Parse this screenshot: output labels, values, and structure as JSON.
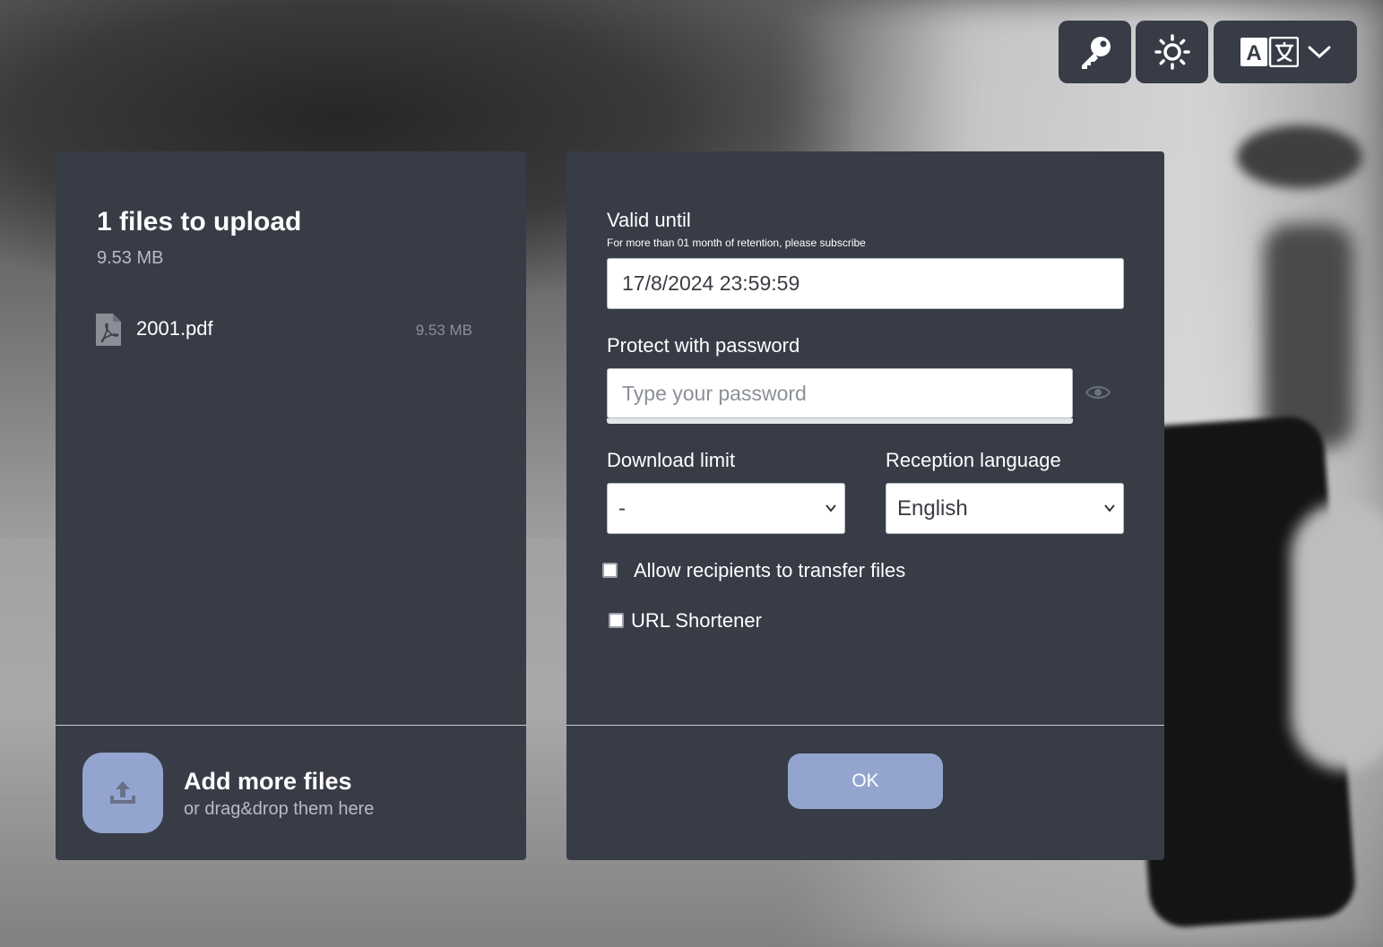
{
  "toolbar": {
    "key_icon": "key-icon",
    "theme_icon": "sun-icon",
    "language_icon": "translate-icon",
    "language_dropdown_icon": "chevron-down-icon"
  },
  "upload": {
    "title": "1 files to upload",
    "total_size": "9.53 MB",
    "files": [
      {
        "name": "2001.pdf",
        "size": "9.53 MB",
        "icon": "pdf-file-icon"
      }
    ],
    "add_more_title": "Add more files",
    "add_more_subtitle": "or drag&drop them here"
  },
  "options": {
    "valid_until_label": "Valid until",
    "valid_until_hint": "For more than 01 month of retention, please subscribe",
    "valid_until_value": "17/8/2024 23:59:59",
    "password_label": "Protect with password",
    "password_placeholder": "Type your password",
    "download_limit_label": "Download limit",
    "download_limit_value": "-",
    "reception_language_label": "Reception language",
    "reception_language_value": "English",
    "allow_transfer_label": "Allow recipients to transfer files",
    "allow_transfer_checked": false,
    "url_shortener_label": "URL Shortener",
    "url_shortener_checked": false,
    "ok_label": "OK"
  },
  "colors": {
    "panel": "#383c47",
    "accent": "#93a5cf",
    "text": "#ffffff",
    "muted_text": "#b7bbc4"
  }
}
